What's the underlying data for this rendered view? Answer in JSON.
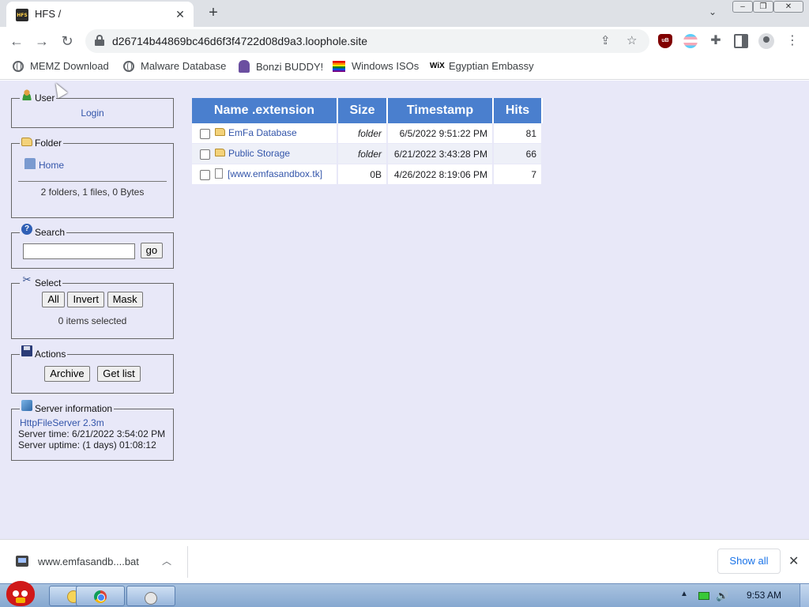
{
  "browser": {
    "tab": {
      "title": "HFS /",
      "favicon": "hfs-icon",
      "favicon_text": "HFS"
    },
    "url": "d26714b44869bc46d6f3f4722d08d9a3.loophole.site",
    "bookmarks": [
      {
        "label": "MEMZ Download",
        "icon": "globe-icon"
      },
      {
        "label": "Malware Database",
        "icon": "globe-icon"
      },
      {
        "label": "Bonzi BUDDY!",
        "icon": "bonzi-icon"
      },
      {
        "label": "Windows ISOs",
        "icon": "rainbow-flag-icon"
      },
      {
        "label": "Egyptian Embassy",
        "icon": "wix-icon",
        "icon_text": "WiX"
      }
    ],
    "extensions": {
      "ublock_text": "uB"
    }
  },
  "sidebar": {
    "user": {
      "legend": "User",
      "login": "Login"
    },
    "folder": {
      "legend": "Folder",
      "home": "Home",
      "summary": "2 folders, 1 files, 0 Bytes"
    },
    "search": {
      "legend": "Search",
      "input_value": "",
      "go": "go"
    },
    "select": {
      "legend": "Select",
      "all": "All",
      "invert": "Invert",
      "mask": "Mask",
      "status": "0 items selected"
    },
    "actions": {
      "legend": "Actions",
      "archive": "Archive",
      "get_list": "Get list"
    },
    "server": {
      "legend": "Server information",
      "software": "HttpFileServer 2.3m",
      "time": "Server time: 6/21/2022 3:54:02 PM",
      "uptime": "Server uptime: (1 days) 01:08:12"
    }
  },
  "table": {
    "headers": {
      "name": "Name .extension",
      "size": "Size",
      "timestamp": "Timestamp",
      "hits": "Hits"
    },
    "rows": [
      {
        "name": "EmFa Database",
        "type": "folder",
        "size": "folder",
        "timestamp": "6/5/2022 9:51:22 PM",
        "hits": "81"
      },
      {
        "name": "Public Storage",
        "type": "folder",
        "size": "folder",
        "timestamp": "6/21/2022 3:43:28 PM",
        "hits": "66"
      },
      {
        "name": "[www.emfasandbox.tk]",
        "type": "file",
        "size": "0B",
        "timestamp": "4/26/2022 8:19:06 PM",
        "hits": "7"
      }
    ]
  },
  "download": {
    "filename": "www.emfasandb....bat",
    "show_all": "Show all"
  },
  "taskbar": {
    "clock": "9:53 AM"
  },
  "colors": {
    "page_bg": "#e8e8f8",
    "table_header": "#4a7fce",
    "link": "#3355aa"
  }
}
